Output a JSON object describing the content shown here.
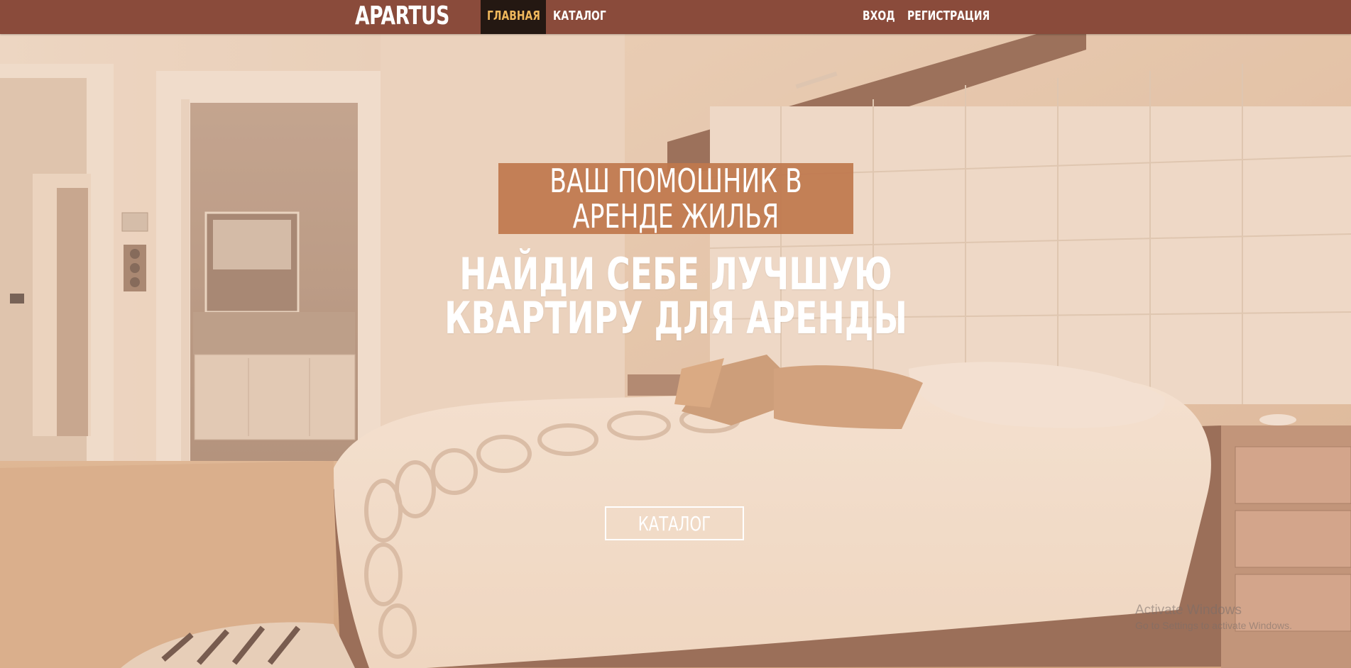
{
  "navbar": {
    "brand": "APARTUS",
    "left_links": [
      {
        "label": "ГЛАВНАЯ",
        "active": true
      },
      {
        "label": "КАТАЛОГ",
        "active": false
      }
    ],
    "right_links": [
      {
        "label": "ВХОД"
      },
      {
        "label": "РЕГИСТРАЦИЯ"
      }
    ]
  },
  "hero": {
    "tagline": "ВАШ ПОМОШНИК В АРЕНДЕ ЖИЛЬЯ",
    "headline": "НАЙДИ СЕБЕ ЛУЧШУЮ КВАРТИРУ ДЛЯ АРЕНДЫ",
    "cta_label": "КАТАЛОГ"
  },
  "watermark": {
    "title": "Activate Windows",
    "subtitle": "Go to Settings to activate Windows."
  },
  "colors": {
    "navbar": "#8a4b3b",
    "nav_active_bg": "#241812",
    "nav_active_text": "#f0b85c",
    "tagline_bg": "#bf784e",
    "text": "#ffffff"
  }
}
